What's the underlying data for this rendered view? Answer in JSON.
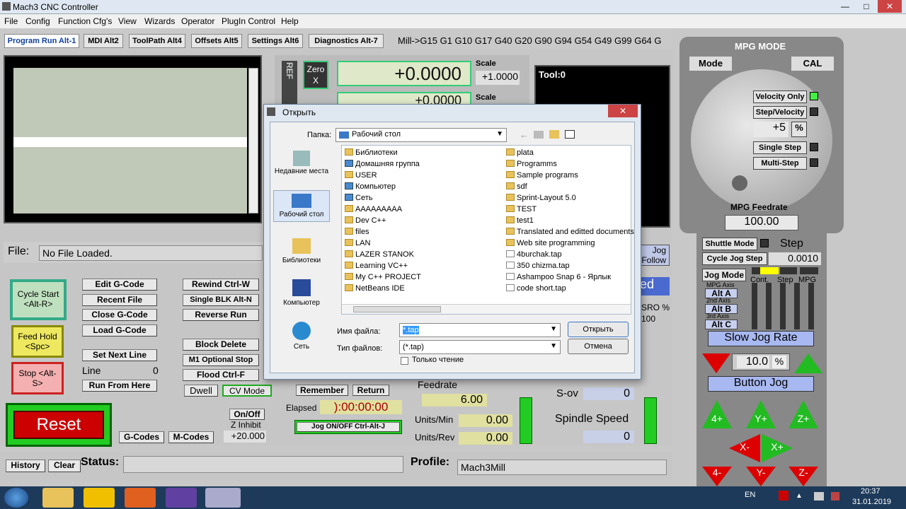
{
  "window": {
    "title": "Mach3 CNC Controller"
  },
  "menu": [
    "File",
    "Config",
    "Function Cfg's",
    "View",
    "Wizards",
    "Operator",
    "PlugIn Control",
    "Help"
  ],
  "tabs": [
    "Program Run Alt-1",
    "MDI Alt2",
    "ToolPath Alt4",
    "Offsets Alt5",
    "Settings Alt6",
    "Diagnostics Alt-7"
  ],
  "gcodes": "Mill->G15  G1 G10 G17 G40 G20 G90 G94 G54 G49 G99 G64 G",
  "dro": {
    "ref": "REF",
    "zero_x": "Zero X",
    "x_value": "+0.0000",
    "x_value2": "+0.0000",
    "scale_label": "Scale",
    "scale_value": "+1.0000",
    "scale_label2": "Scale",
    "tool": "Tool:0"
  },
  "file": {
    "label": "File:",
    "value": "No File Loaded."
  },
  "buttons": {
    "cycle_start": "Cycle Start <Alt-R>",
    "feed_hold": "Feed Hold <Spc>",
    "stop": "Stop <Alt-S>",
    "reset": "Reset",
    "edit_gcode": "Edit G-Code",
    "recent_file": "Recent File",
    "close_gcode": "Close G-Code",
    "load_gcode": "Load G-Code",
    "set_next_line": "Set Next Line",
    "run_from_here": "Run From Here",
    "rewind": "Rewind Ctrl-W",
    "single_blk": "Single BLK Alt-N",
    "reverse_run": "Reverse Run",
    "block_delete": "Block Delete",
    "m1_optional": "M1 Optional Stop",
    "flood": "Flood Ctrl-F",
    "dwell": "Dwell",
    "cv_mode": "CV Mode",
    "on_off": "On/Off",
    "g_codes": "G-Codes",
    "m_codes": "M-Codes",
    "history": "History",
    "clear": "Clear",
    "remember": "Remember",
    "return": "Return",
    "jog_onoff": "Jog ON/OFF Ctrl-Alt-J",
    "jog_follow": "Jog Follow"
  },
  "line": {
    "label": "Line",
    "value": "0"
  },
  "z_inhibit": {
    "label": "Z Inhibit",
    "value": "+20.000"
  },
  "elapsed": {
    "label": "Elapsed",
    "value": "):00:00:00"
  },
  "feed": {
    "feedrate_label": "Feedrate",
    "feedrate": "6.00",
    "units_min_label": "Units/Min",
    "units_min": "0.00",
    "units_rev_label": "Units/Rev",
    "units_rev": "0.00"
  },
  "spindle": {
    "sov_label": "S-ov",
    "sov": "0",
    "speed_label": "Spindle Speed",
    "speed": "0",
    "sro": "SRO %",
    "sro_val": "100",
    "red_label": "ed"
  },
  "status": {
    "label": "Status:",
    "profile_label": "Profile:",
    "profile": "Mach3Mill"
  },
  "mpg": {
    "title": "MPG MODE",
    "mode": "Mode",
    "cal": "CAL",
    "velocity_only": "Velocity Only",
    "step_velocity": "Step/Velocity",
    "step_val": "+5",
    "pct": "%",
    "single_step": "Single Step",
    "multi_step": "Multi-Step",
    "feedrate_label": "MPG Feedrate",
    "feedrate": "100.00",
    "shuttle_mode": "Shuttle Mode",
    "step": "Step",
    "cycle_jog_step": "Cycle Jog Step",
    "jog_step_val": "0.0010",
    "jog_mode": "Jog Mode",
    "cont": "Cont.",
    "step2": "Step",
    "mpg2": "MPG",
    "mpg_axis": "MPG Axis",
    "alt_a": "Alt A",
    "axis2": "2nd Axis",
    "alt_b": "Alt B",
    "axis3": "3rd Axis",
    "alt_c": "Alt C",
    "slow_jog_rate": "Slow Jog Rate",
    "jog_rate": "10.0",
    "button_jog": "Button Jog",
    "jog_buttons": [
      "4+",
      "Y+",
      "Z+",
      "X-",
      "X+",
      "4-",
      "Y-",
      "Z-"
    ]
  },
  "dialog": {
    "title": "Открыть",
    "look_in_label": "Папка:",
    "look_in": "Рабочий стол",
    "places": [
      "Недавние места",
      "Рабочий стол",
      "Библиотеки",
      "Компьютер",
      "Сеть"
    ],
    "files_col1": [
      {
        "name": "Библиотеки",
        "t": "folder"
      },
      {
        "name": "Домашняя группа",
        "t": "net"
      },
      {
        "name": "USER",
        "t": "folder"
      },
      {
        "name": "Компьютер",
        "t": "net"
      },
      {
        "name": "Сеть",
        "t": "net"
      },
      {
        "name": "AAAAAAAAA",
        "t": "folder"
      },
      {
        "name": "Dev C++",
        "t": "folder"
      },
      {
        "name": "files",
        "t": "folder"
      },
      {
        "name": "LAN",
        "t": "folder"
      },
      {
        "name": "LAZER STANOK",
        "t": "folder"
      },
      {
        "name": "Learning VC++",
        "t": "folder"
      },
      {
        "name": "My C++ PROJECT",
        "t": "folder"
      },
      {
        "name": "NetBeans IDE",
        "t": "folder"
      }
    ],
    "files_col2": [
      {
        "name": "plata",
        "t": "folder"
      },
      {
        "name": "Programms",
        "t": "folder"
      },
      {
        "name": "Sample programs",
        "t": "folder"
      },
      {
        "name": "sdf",
        "t": "folder"
      },
      {
        "name": "Sprint-Layout 5.0",
        "t": "folder"
      },
      {
        "name": "TEST",
        "t": "folder"
      },
      {
        "name": "test1",
        "t": "folder"
      },
      {
        "name": "Translated and editted documents",
        "t": "folder"
      },
      {
        "name": "Web site programming",
        "t": "folder"
      },
      {
        "name": "4burchak.tap",
        "t": "file"
      },
      {
        "name": "350 chizma.tap",
        "t": "file"
      },
      {
        "name": "Ashampoo Snap 6 - Ярлык",
        "t": "file"
      },
      {
        "name": "code short.tap",
        "t": "file"
      }
    ],
    "filename_label": "Имя файла:",
    "filename": "*.tap",
    "filetype_label": "Тип файлов:",
    "filetype": "(*.tap)",
    "readonly": "Только чтение",
    "open": "Открыть",
    "cancel": "Отмена"
  },
  "taskbar": {
    "lang": "EN",
    "time": "20:37",
    "date": "31.01.2019"
  }
}
